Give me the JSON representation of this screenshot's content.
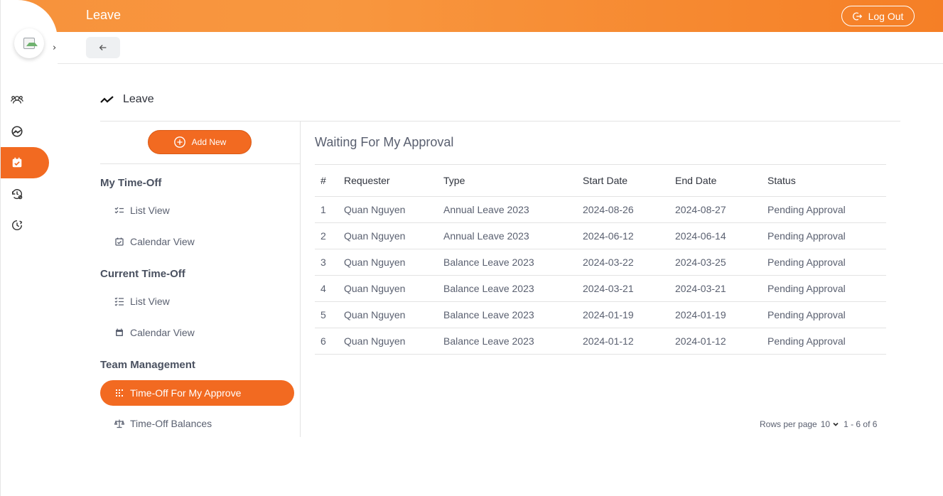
{
  "header": {
    "title": "Leave",
    "logout_label": "Log Out"
  },
  "rail": {
    "items": [
      {
        "icon": "users-icon"
      },
      {
        "icon": "dashboard-icon"
      },
      {
        "icon": "calendar-check-icon",
        "active": true
      },
      {
        "icon": "history-settings-icon"
      },
      {
        "icon": "clock-history-icon"
      }
    ]
  },
  "page": {
    "heading": "Leave"
  },
  "left_panel": {
    "add_new_label": "Add New",
    "sections": [
      {
        "title": "My Time-Off",
        "items": [
          "List View",
          "Calendar View"
        ]
      },
      {
        "title": "Current Time-Off",
        "items": [
          "List View",
          "Calendar View"
        ]
      },
      {
        "title": "Team Management",
        "items": [
          "Time-Off For My Approve",
          "Time-Off Balances"
        ]
      }
    ]
  },
  "main": {
    "title": "Waiting For My Approval",
    "columns": [
      "#",
      "Requester",
      "Type",
      "Start Date",
      "End Date",
      "Status"
    ],
    "rows": [
      [
        "1",
        "Quan Nguyen",
        "Annual Leave 2023",
        "2024-08-26",
        "2024-08-27",
        "Pending Approval"
      ],
      [
        "2",
        "Quan Nguyen",
        "Annual Leave 2023",
        "2024-06-12",
        "2024-06-14",
        "Pending Approval"
      ],
      [
        "3",
        "Quan Nguyen",
        "Balance Leave 2023",
        "2024-03-22",
        "2024-03-25",
        "Pending Approval"
      ],
      [
        "4",
        "Quan Nguyen",
        "Balance Leave 2023",
        "2024-03-21",
        "2024-03-21",
        "Pending Approval"
      ],
      [
        "5",
        "Quan Nguyen",
        "Balance Leave 2023",
        "2024-01-19",
        "2024-01-19",
        "Pending Approval"
      ],
      [
        "6",
        "Quan Nguyen",
        "Balance Leave 2023",
        "2024-01-12",
        "2024-01-12",
        "Pending Approval"
      ]
    ],
    "pagination": {
      "rows_per_page_label": "Rows per page",
      "rows_per_page_value": "10",
      "range": "1 - 6 of 6"
    }
  },
  "colors": {
    "accent": "#f26a21",
    "header_start": "#f7923c",
    "header_end": "#f57f26"
  }
}
